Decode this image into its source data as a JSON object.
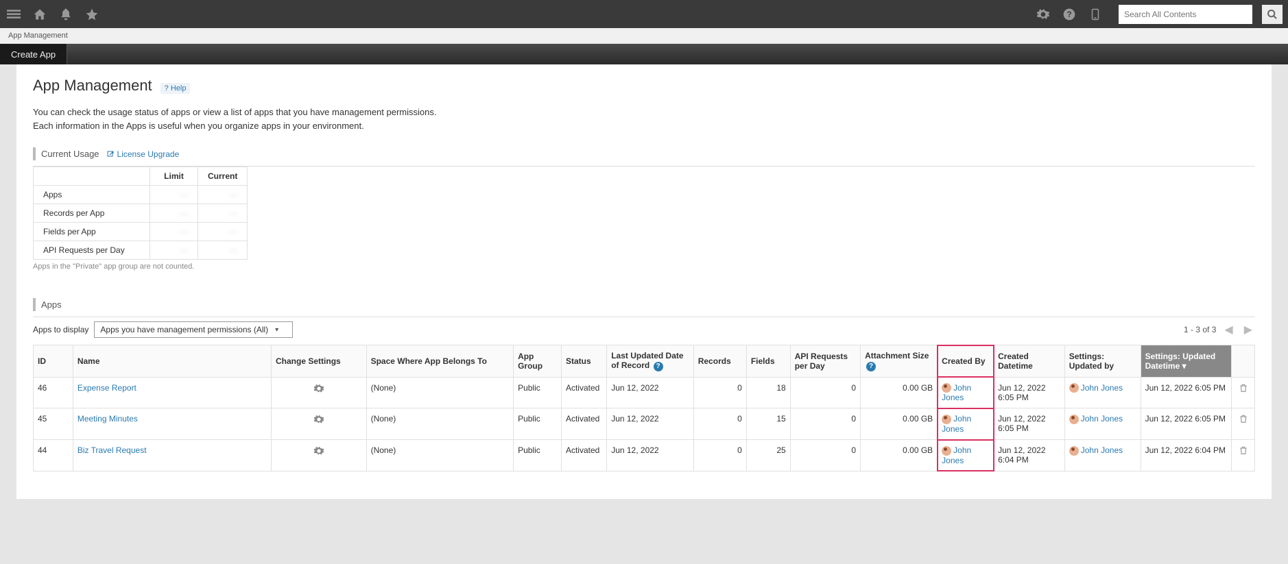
{
  "topbar": {
    "search_placeholder": "Search All Contents"
  },
  "breadcrumb": "App Management",
  "secondbar": {
    "create_app": "Create App"
  },
  "page": {
    "title": "App Management",
    "help_label": "? Help",
    "intro_line1": "You can check the usage status of apps or view a list of apps that you have management permissions.",
    "intro_line2": "Each information in the Apps is useful when you organize apps in your environment."
  },
  "usage": {
    "heading": "Current Usage",
    "license_link": "License Upgrade",
    "cols": {
      "limit": "Limit",
      "current": "Current"
    },
    "rows": [
      {
        "label": "Apps",
        "limit": "—",
        "current": "—"
      },
      {
        "label": "Records per App",
        "limit": "—",
        "current": "—"
      },
      {
        "label": "Fields per App",
        "limit": "—",
        "current": "—"
      },
      {
        "label": "API Requests per Day",
        "limit": "—",
        "current": "—"
      }
    ],
    "note": "Apps in the \"Private\" app group are not counted."
  },
  "apps": {
    "heading": "Apps",
    "display_label": "Apps to display",
    "display_select": "Apps you have management permissions (All)",
    "page_info": "1 - 3 of 3",
    "cols": {
      "id": "ID",
      "name": "Name",
      "change": "Change Settings",
      "space": "Space Where App Belongs To",
      "group": "App Group",
      "status": "Status",
      "lastupd": "Last Updated Date of Record",
      "records": "Records",
      "fields": "Fields",
      "api": "API Requests per Day",
      "attach": "Attachment Size",
      "createdby": "Created By",
      "createdat": "Created Datetime",
      "setupdby": "Settings: Updated by",
      "setupdat": "Settings: Updated Datetime"
    },
    "rows": [
      {
        "id": "46",
        "name": "Expense Report",
        "space": "(None)",
        "group": "Public",
        "status": "Activated",
        "lastupd": "Jun 12, 2022",
        "records": "0",
        "fields": "18",
        "api": "0",
        "attach": "0.00 GB",
        "createdby": "John Jones",
        "createdat": "Jun 12, 2022 6:05 PM",
        "setupdby": "John Jones",
        "setupdat": "Jun 12, 2022 6:05 PM"
      },
      {
        "id": "45",
        "name": "Meeting Minutes",
        "space": "(None)",
        "group": "Public",
        "status": "Activated",
        "lastupd": "Jun 12, 2022",
        "records": "0",
        "fields": "15",
        "api": "0",
        "attach": "0.00 GB",
        "createdby": "John Jones",
        "createdat": "Jun 12, 2022 6:05 PM",
        "setupdby": "John Jones",
        "setupdat": "Jun 12, 2022 6:05 PM"
      },
      {
        "id": "44",
        "name": "Biz Travel Request",
        "space": "(None)",
        "group": "Public",
        "status": "Activated",
        "lastupd": "Jun 12, 2022",
        "records": "0",
        "fields": "25",
        "api": "0",
        "attach": "0.00 GB",
        "createdby": "John Jones",
        "createdat": "Jun 12, 2022 6:04 PM",
        "setupdby": "John Jones",
        "setupdat": "Jun 12, 2022 6:04 PM"
      }
    ]
  }
}
